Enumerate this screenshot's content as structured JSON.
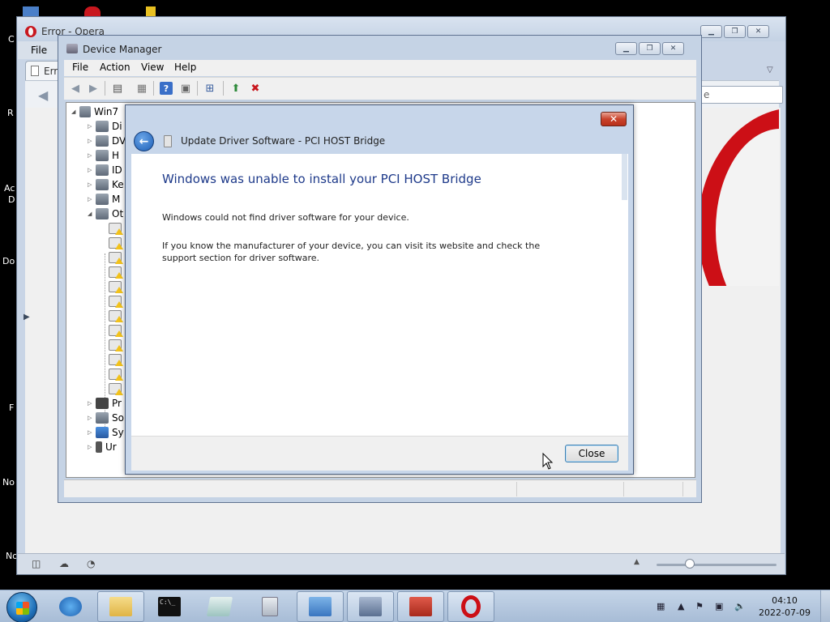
{
  "desktop": {
    "labels": [
      "C",
      "R",
      "Ac",
      "D",
      "Do",
      "F",
      "No",
      "No"
    ]
  },
  "opera": {
    "title": "Error - Opera",
    "menu_file": "File",
    "tab_label": "Erro",
    "search_placeholder": "e"
  },
  "device_manager": {
    "title": "Device Manager",
    "menu": [
      "File",
      "Action",
      "View",
      "Help"
    ],
    "tree": {
      "root": "Win7",
      "items": [
        "Di",
        "DV",
        "H",
        "ID",
        "Ke",
        "M",
        "Ot",
        "Pr",
        "So",
        "Sy",
        "Ur"
      ]
    }
  },
  "dialog": {
    "title": "Update Driver Software - PCI HOST Bridge",
    "heading": "Windows was unable to install your PCI HOST Bridge",
    "paragraph1": "Windows could not find driver software for your device.",
    "paragraph2": "If you know the manufacturer of your device, you can visit its website and check the support section for driver software.",
    "close_button": "Close",
    "close_glyph": "✕"
  },
  "taskbar": {
    "cmd_label": "C:\\_",
    "time": "04:10",
    "date": "2022-07-09"
  },
  "colors": {
    "accent": "#1e3a8a",
    "opera_red": "#cc0f16",
    "taskbar": "#b5c8df"
  }
}
